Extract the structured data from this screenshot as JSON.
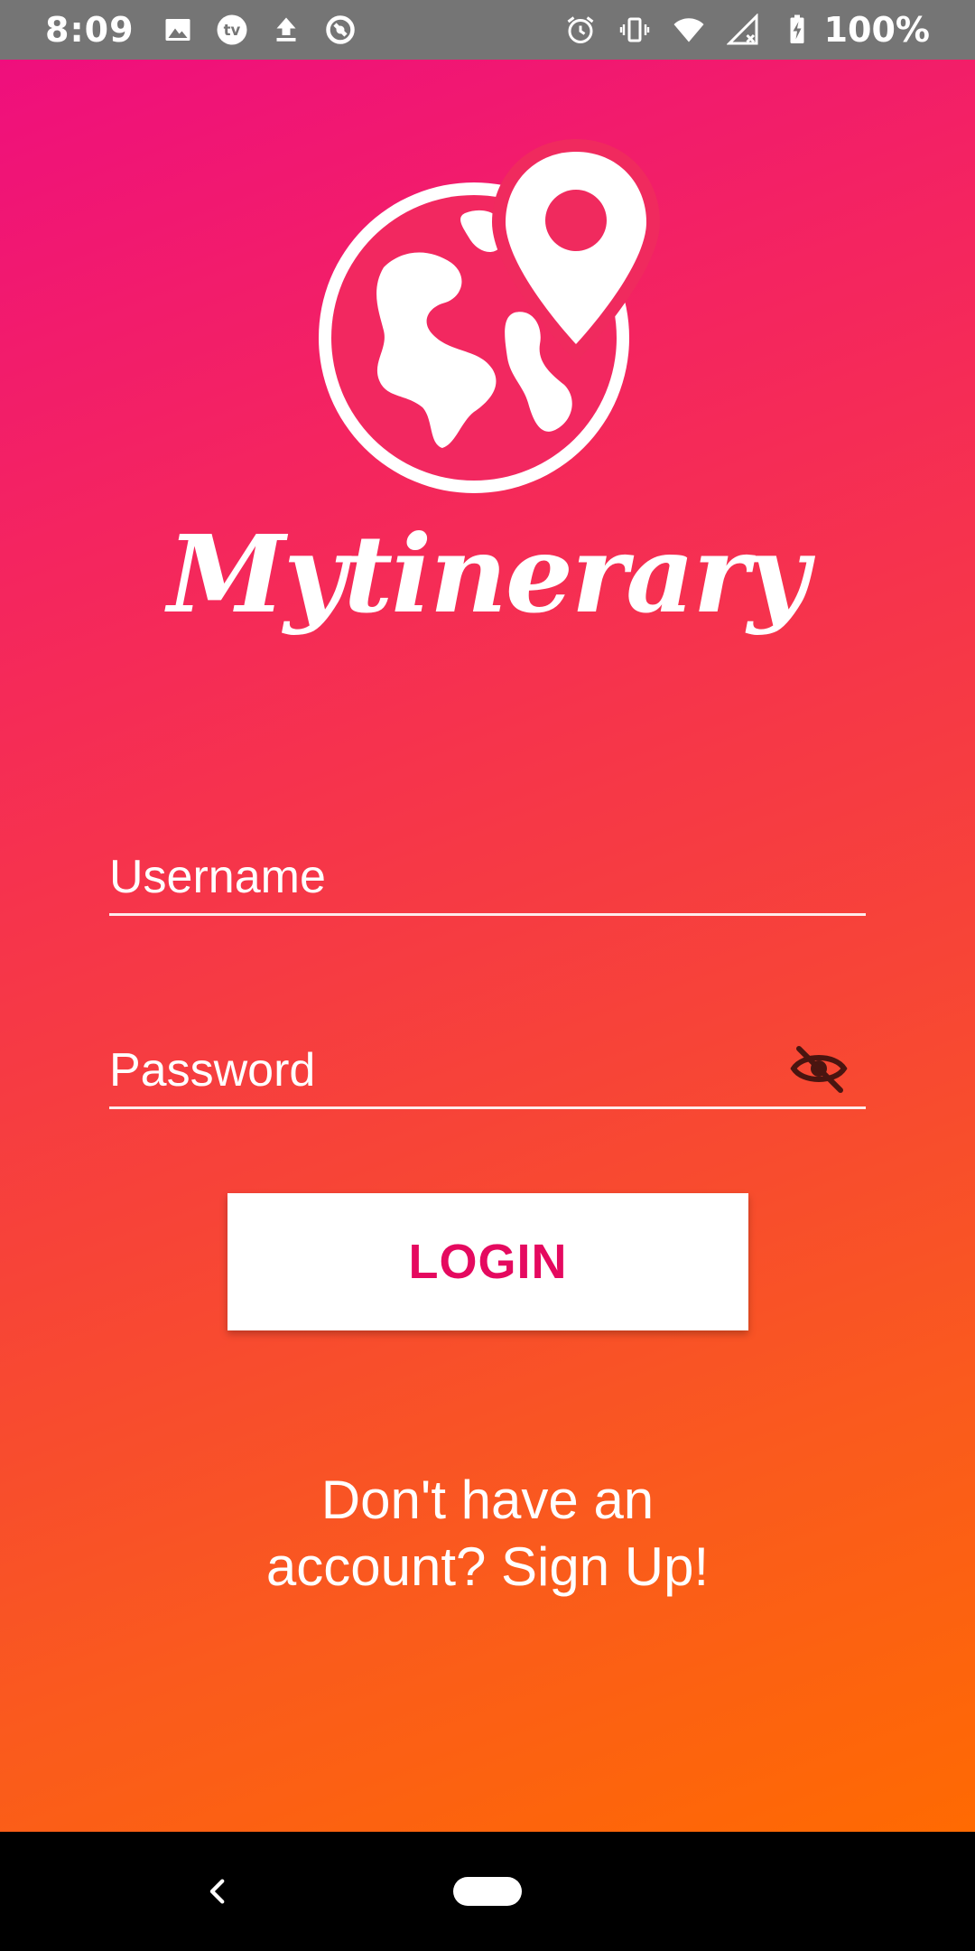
{
  "status_bar": {
    "time": "8:09",
    "battery_text": "100%",
    "left_icons": [
      "image-icon",
      "tv-icon",
      "upload-icon",
      "sync-icon"
    ],
    "right_icons": [
      "alarm-icon",
      "vibrate-icon",
      "wifi-icon",
      "signal-icon",
      "battery-charging-icon"
    ]
  },
  "brand": {
    "name": "Mytinerary",
    "logo_icon": "globe-pin-icon"
  },
  "form": {
    "username_placeholder": "Username",
    "password_placeholder": "Password",
    "password_toggle_icon": "eye-off-icon",
    "login_label": "LOGIN",
    "signup_text": "Don't have an account? Sign Up!"
  },
  "nav_bar": {
    "back_icon": "back-chevron-icon",
    "home_icon": "home-pill-icon"
  },
  "colors": {
    "gradient_start": "#ef0f7d",
    "gradient_end": "#ff6a02",
    "login_text": "#e5095f",
    "status_bar": "#757575"
  }
}
